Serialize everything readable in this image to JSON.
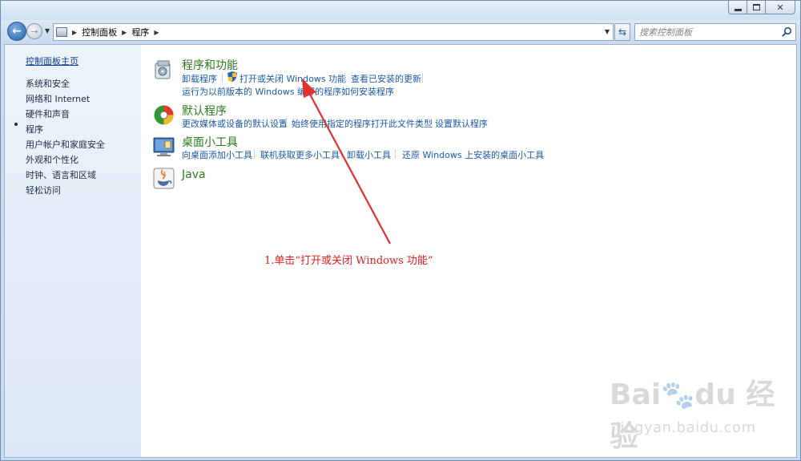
{
  "breadcrumb": [
    "控制面板",
    "程序"
  ],
  "search": {
    "placeholder": "搜索控制面板"
  },
  "sidebar": {
    "home": "控制面板主页",
    "items": [
      "系统和安全",
      "网络和 Internet",
      "硬件和声音",
      "程序",
      "用户帐户和家庭安全",
      "外观和个性化",
      "时钟、语言和区域",
      "轻松访问"
    ],
    "selected": "程序"
  },
  "categories": [
    {
      "title": "程序和功能",
      "icon": "programs-features-icon",
      "links_row1": [
        "卸载程序",
        "打开或关闭 Windows 功能",
        "查看已安装的更新"
      ],
      "links_row2": [
        "运行为以前版本的 Windows 编写的程序",
        "如何安装程序"
      ]
    },
    {
      "title": "默认程序",
      "icon": "default-programs-icon",
      "links_row1": [
        "更改媒体或设备的默认设置",
        "始终使用指定的程序打开此文件类型",
        "设置默认程序"
      ]
    },
    {
      "title": "桌面小工具",
      "icon": "desktop-gadgets-icon",
      "links_row1": [
        "向桌面添加小工具",
        "联机获取更多小工具",
        "卸载小工具",
        "还原 Windows 上安装的桌面小工具"
      ]
    },
    {
      "title": "Java",
      "icon": "java-icon"
    }
  ],
  "annotation": "1.单击“打开或关闭 Windows 功能”",
  "watermark": {
    "logo": "Bai du 经验",
    "url": "jingyan.baidu.com"
  },
  "colors": {
    "link": "#1b5aa6",
    "category_title": "#2b7a1f",
    "annotation": "#e02020"
  }
}
